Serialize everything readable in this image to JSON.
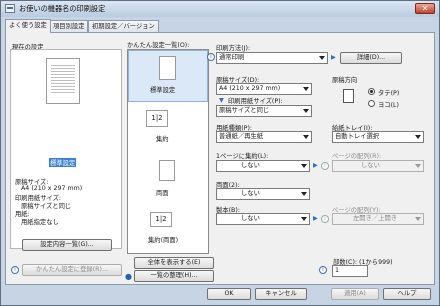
{
  "window": {
    "title": "お使いの機器名の印刷設定"
  },
  "tabs": [
    "よく使う設定",
    "項目別設定",
    "初期設定／バージョン"
  ],
  "left": {
    "current_label": "現在の設定",
    "setting_name": "標準設定",
    "details": [
      "原稿サイズ:",
      "A4 (210 x 297 mm)",
      "印刷用紙サイズ:",
      "原稿サイズと同じ",
      "用紙:",
      "用紙指定なし"
    ],
    "list_button": "設定内容一覧(G)...",
    "register_button": "かんたん設定に登録(R)..."
  },
  "presets": {
    "label": "かんたん設定一覧(O):",
    "items": [
      "標準設定",
      "集約",
      "両面",
      "集約(両面)"
    ],
    "show_all_button": "全体を表示する(E)",
    "organize_button": "一覧の整理(H)..."
  },
  "right": {
    "print_method_label": "印刷方法(J):",
    "print_method_value": "通常印刷",
    "detail_button": "詳細(D)...",
    "orig_size_label": "原稿サイズ(D):",
    "orig_size_value": "A4 (210 x 297 mm)",
    "paper_size_label": "印刷用紙サイズ(P):",
    "paper_size_value": "原稿サイズと同じ",
    "orientation_label": "原稿方向",
    "portrait_label": "タテ(P)",
    "landscape_label": "ヨコ(L)",
    "paper_type_label": "用紙種類(P):",
    "paper_type_value": "普通紙／再生紙",
    "tray_label": "給紙トレイ(I):",
    "tray_value": "自動トレイ選択",
    "nup_label": "1ページに集約(L):",
    "nup_value": "しない",
    "page_order_label": "ページの配列(R):",
    "page_order_value": "しない",
    "duplex_label": "両面(2):",
    "duplex_value": "しない",
    "booklet_label": "製本(B):",
    "booklet_value": "しない",
    "booklet_order_label": "ページの配列(Y):",
    "booklet_order_value": "左開き／上開き",
    "copies_label": "部数(C): (1から999)",
    "copies_value": "1"
  },
  "footer": {
    "ok": "OK",
    "cancel": "キャンセル",
    "apply": "適用(A)",
    "help": "ヘルプ"
  }
}
